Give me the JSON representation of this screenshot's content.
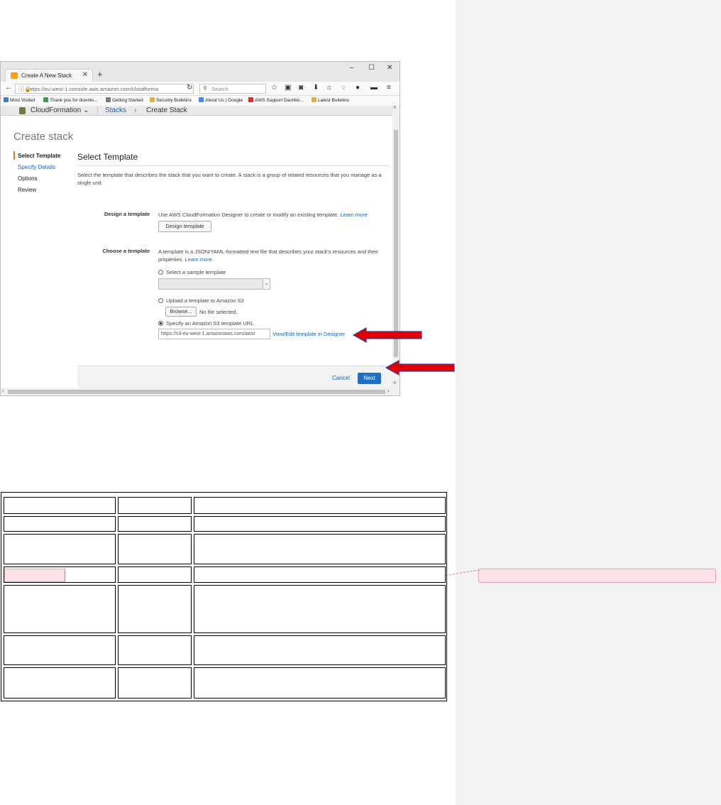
{
  "browser": {
    "tab_title": "Create A New Stack",
    "tab_close": "✕",
    "new_tab": "+",
    "window_controls": [
      "–",
      "☐",
      "✕"
    ],
    "url": "https://eu-west-1.console.aws.amazon.com/cloudforma",
    "search_placeholder": "Search",
    "bookmarks": [
      {
        "label": "Most Visited",
        "color": "#3a7bd5"
      },
      {
        "label": "Thank you for downlo...",
        "color": "#2ea44f"
      },
      {
        "label": "Getting Started",
        "color": "#7a7a7a"
      },
      {
        "label": "Security Bulletins",
        "color": "#e8b02a"
      },
      {
        "label": "About Us | Google",
        "color": "#4285f4"
      },
      {
        "label": "AWS Support Dashbo...",
        "color": "#d93025"
      },
      {
        "label": "Latest Bulletins",
        "color": "#e8b02a"
      }
    ]
  },
  "aws_nav": {
    "service": "CloudFormation",
    "service_caret": "⌄",
    "breadcrumb_stacks": "Stacks",
    "breadcrumb_sep": "›",
    "breadcrumb_current": "Create Stack"
  },
  "wizard": {
    "page_title": "Create stack",
    "steps": [
      "Select Template",
      "Specify Details",
      "Options",
      "Review"
    ],
    "section_title": "Select Template",
    "description": "Select the template that describes the stack that you want to create. A stack is a group of related resources that you manage as a single unit.",
    "design": {
      "label": "Design a template",
      "text": "Use AWS CloudFormation Designer to create or modify an existing template.",
      "learn_more": "Learn more",
      "button": "Design template"
    },
    "choose": {
      "label": "Choose a template",
      "text": "A template is a JSON/YAML-formatted text file that describes your stack's resources and their properties.",
      "learn_more": "Learn more.",
      "option_sample": "Select a sample template",
      "option_upload": "Upload a template to Amazon S3",
      "browse_button": "Browse...",
      "no_file": "No file selected.",
      "option_url": "Specify an Amazon S3 template URL",
      "url_value": "https://s3-eu-west-1.amazonaws.com/awsr",
      "designer_link": "View/Edit template in Designer",
      "selected_option": "Specify an Amazon S3 template URL"
    },
    "cancel": "Cancel",
    "next": "Next"
  },
  "colors": {
    "aws_link": "#1166bb",
    "primary_button": "#1f6fc5",
    "active_step": "#ec7211",
    "arrow_red": "#e00000",
    "arrow_outline": "#2f3fa0",
    "comment_fill": "#fde2e8"
  }
}
